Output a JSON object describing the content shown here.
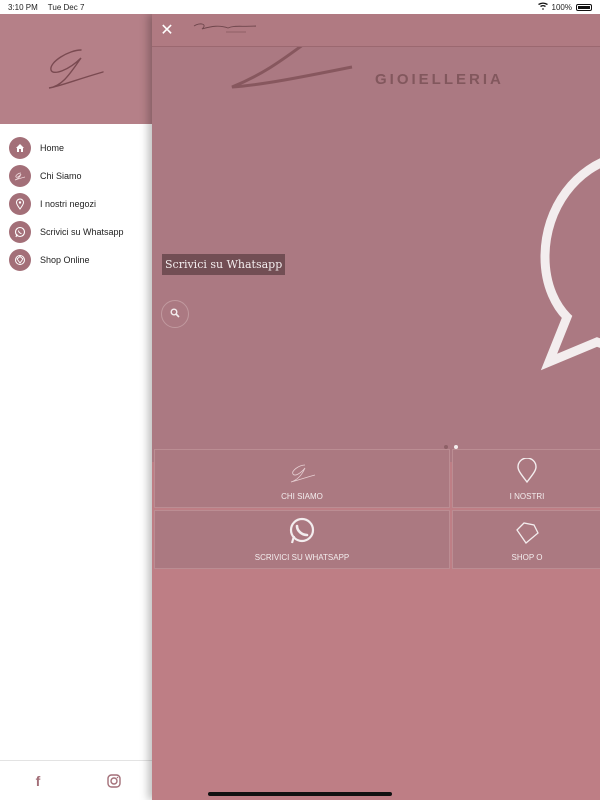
{
  "status_bar": {
    "time": "3:10 PM",
    "date": "Tue Dec 7",
    "battery": "100%"
  },
  "sidebar": {
    "items": [
      {
        "label": "Home",
        "icon": "home-icon"
      },
      {
        "label": "Chi Siamo",
        "icon": "logo-g-icon"
      },
      {
        "label": "I nostri negozi",
        "icon": "location-pin-icon"
      },
      {
        "label": "Scrivici su Whatsapp",
        "icon": "whatsapp-icon"
      },
      {
        "label": "Shop Online",
        "icon": "diamond-icon"
      }
    ],
    "footer": {
      "facebook_icon": "f",
      "instagram_icon": "instagram-icon"
    }
  },
  "main": {
    "hero": {
      "brand_text": "GIOIELLERIA",
      "label": "Scrivici su Whatsapp",
      "carousel_dots": 2,
      "active_dot": 2
    },
    "tiles": [
      {
        "label": "CHI SIAMO",
        "icon": "logo-g-icon"
      },
      {
        "label": "I NOSTRI",
        "icon": "location-pin-icon"
      },
      {
        "label": "SCRIVICI SU WHATSAPP",
        "icon": "whatsapp-icon"
      },
      {
        "label": "SHOP O",
        "icon": "diamond-icon"
      }
    ]
  },
  "colors": {
    "accent": "#a36f78",
    "panel_bg": "#c38188",
    "hero_bg": "#ad7c84"
  }
}
